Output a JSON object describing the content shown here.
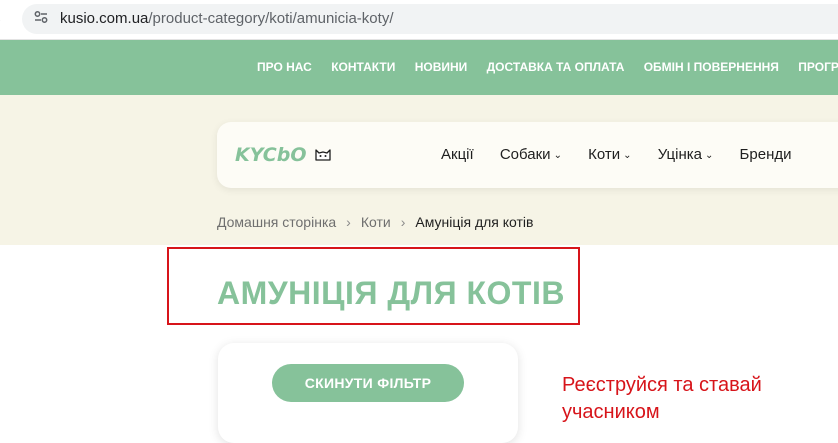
{
  "browser": {
    "url_host": "kusio.com.ua",
    "url_path": "/product-category/koti/amunicia-koty/"
  },
  "topnav": {
    "items": [
      "ПРО НАС",
      "КОНТАКТИ",
      "НОВИНИ",
      "ДОСТАВКА ТА ОПЛАТА",
      "ОБМІН І ПОВЕРНЕННЯ",
      "ПРОГРАМА ЛОЯЛЬНОСТІ"
    ]
  },
  "logo": {
    "text": "KYCbO"
  },
  "menu": {
    "items": [
      {
        "label": "Акції"
      },
      {
        "label": "Собаки"
      },
      {
        "label": "Коти"
      },
      {
        "label": "Уцінка"
      },
      {
        "label": "Бренди"
      }
    ]
  },
  "breadcrumb": {
    "home": "Домашня сторінка",
    "parent": "Коти",
    "current": "Амуніція для котів"
  },
  "page": {
    "title": "АМУНІЦІЯ ДЛЯ КОТІВ"
  },
  "filter": {
    "reset_label": "СКИНУТИ ФІЛЬТР"
  },
  "promo": {
    "text": "Реєструйся та ставай учасником"
  },
  "colors": {
    "brand_green": "#86c29a",
    "header_beige": "#f6f4e6",
    "highlight_red": "#d7141a"
  }
}
